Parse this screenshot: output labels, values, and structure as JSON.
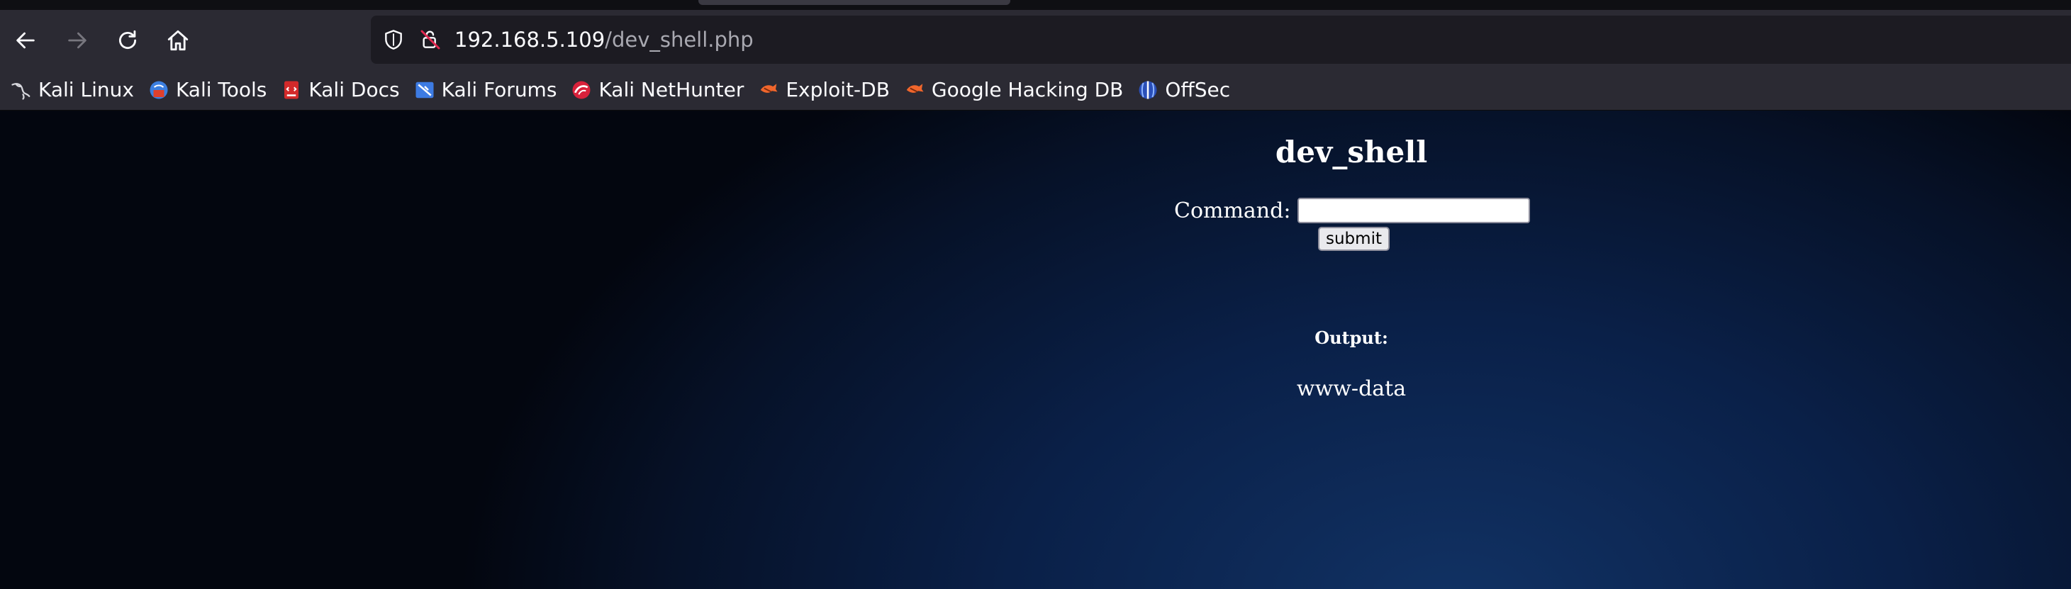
{
  "browser": {
    "url_host": "192.168.5.109",
    "url_path": "/dev_shell.php",
    "bookmarks": [
      {
        "label": "Kali Linux",
        "icon": "kali-dragon-icon"
      },
      {
        "label": "Kali Tools",
        "icon": "kali-tools-icon"
      },
      {
        "label": "Kali Docs",
        "icon": "kali-docs-icon"
      },
      {
        "label": "Kali Forums",
        "icon": "kali-forums-icon"
      },
      {
        "label": "Kali NetHunter",
        "icon": "kali-nethunter-icon"
      },
      {
        "label": "Exploit-DB",
        "icon": "exploit-db-icon"
      },
      {
        "label": "Google Hacking DB",
        "icon": "exploit-db-icon"
      },
      {
        "label": "OffSec",
        "icon": "offsec-icon"
      }
    ]
  },
  "page": {
    "title": "dev_shell",
    "command_label": "Command:",
    "command_value": "",
    "submit_label": "submit",
    "output_label": "Output:",
    "output_value": "www-data"
  },
  "colors": {
    "toolbar": "#2b2a33",
    "urlbar": "#1c1b22",
    "page_bg_center": "#113264",
    "page_bg_edge": "#03060f",
    "text": "#ffffff"
  }
}
